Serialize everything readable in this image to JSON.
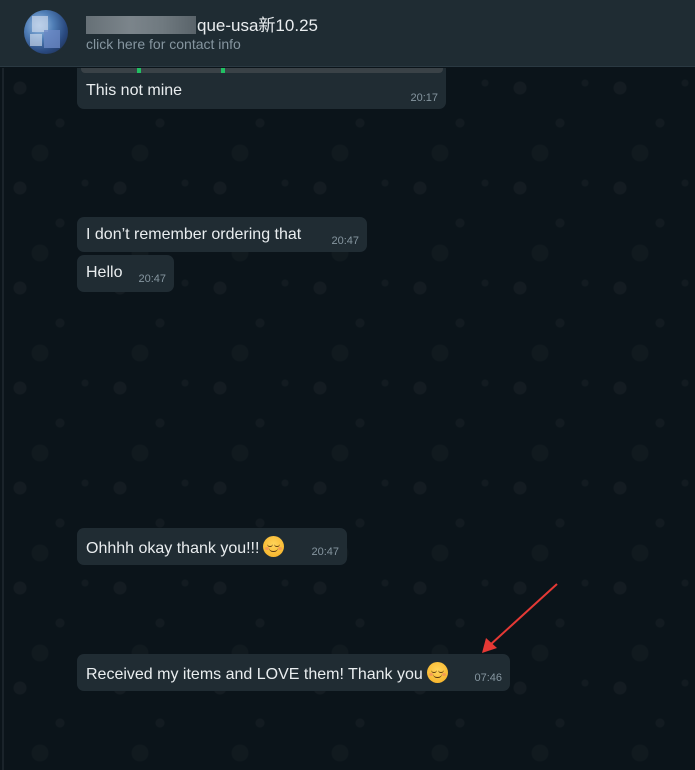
{
  "header": {
    "contact_name_visible": "que-usa新10.25",
    "contact_subtitle": "click here for contact info"
  },
  "messages": [
    {
      "text": "This not mine",
      "time": "20:17"
    },
    {
      "text": "I don’t remember ordering that",
      "time": "20:47"
    },
    {
      "text": "Hello",
      "time": "20:47"
    },
    {
      "text": "Ohhhh okay thank you!!!",
      "emoji": "relieved-face-emoji",
      "time": "20:47"
    },
    {
      "text": "Received my items and LOVE them! Thank you",
      "emoji": "relieved-face-emoji",
      "time": "07:46"
    }
  ],
  "annotation": {
    "type": "arrow",
    "color": "#e53935",
    "points_to": "message-time-07:46"
  },
  "colors": {
    "background": "#0b141a",
    "header": "#1f2c33",
    "bubble_incoming": "#202c33",
    "text_primary": "#e9edef",
    "text_secondary": "#8696a0",
    "arrow": "#e53935"
  }
}
